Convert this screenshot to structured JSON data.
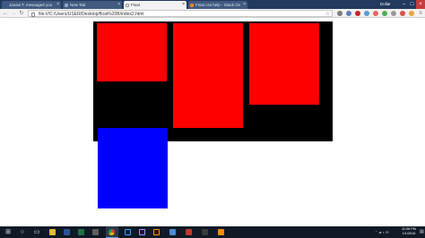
{
  "browser": {
    "tabs": [
      {
        "title": "Janavi T. messaged you",
        "icon": "facebook-icon"
      },
      {
        "title": "New Tab",
        "icon": "page-icon"
      },
      {
        "title": "Float",
        "icon": "page-icon"
      },
      {
        "title": "Float css help - Stack Ov",
        "icon": "stackoverflow-icon"
      }
    ],
    "profile_name": "Dollar",
    "url": "file:///C:/Users/USER/Desktop/float%20B/index2.html"
  },
  "page": {
    "container_color": "#000000",
    "red_box_color": "#ff0000",
    "blue_box_color": "#0000ff",
    "boxes": [
      "box-1",
      "box-2",
      "box-3",
      "box-4"
    ]
  },
  "taskbar": {
    "apps": [
      "start-icon",
      "search-icon",
      "task-view-icon",
      "file-explorer-icon",
      "word-icon",
      "excel-icon",
      "chrome-icon",
      "photoshop-icon",
      "premiere-icon",
      "illustrator-icon",
      "app-icon",
      "app-icon",
      "app-icon",
      "media-player-icon"
    ],
    "clock_time": "11:08 PM",
    "clock_date": "1/1/2016"
  }
}
